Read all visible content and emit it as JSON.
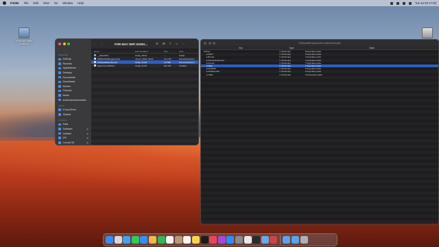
{
  "menubar": {
    "items": [
      "Finder",
      "File",
      "Edit",
      "View",
      "Go",
      "Window",
      "Help"
    ],
    "clock": "Tue Jul 23 17:53"
  },
  "desktop": {
    "icons": [
      {
        "label": "FOR MAC WIFI DONGLE",
        "color": "blue"
      },
      {
        "label": "",
        "color": "gray"
      },
      {
        "label": "",
        "color": "orange"
      },
      {
        "label": "",
        "color": "orange"
      },
      {
        "label": "EFI",
        "color": "gray"
      },
      {
        "label": "Software",
        "color": "gray"
      },
      {
        "label": "EFI",
        "color": "gray"
      }
    ]
  },
  "finder": {
    "title": "FOR MAC WIFI DONG...",
    "toolbar": {
      "view_icon": "list-view-icon",
      "group_icon": "group-icon",
      "share_icon": "share-icon",
      "tag_icon": "tag-icon",
      "more_icon": "more-icon"
    },
    "sidebar": {
      "favorites_header": "Favourites",
      "favorites": [
        "AirDrop",
        "Recents",
        "Applications",
        "Desktop",
        "Documents",
        "Downloads",
        "Movies",
        "Pictures",
        "Music",
        "andrinosmacbookairs"
      ],
      "icloud_header": "iCloud",
      "icloud": [
        "iCloud Drive",
        "Shared"
      ],
      "locations_header": "Locations",
      "locations": [
        "Data",
        "Software",
        "Untitled",
        "EFI",
        "Crucial X8"
      ]
    },
    "columns": [
      "Name",
      "Date Modified",
      "Size",
      "Kind"
    ],
    "rows": [
      {
        "name": "__MACOSX",
        "date": "Today, 18:24",
        "size": "--",
        "kind": "Folder",
        "icon": "folder"
      },
      {
        "name": "IOBCFOrWifiLegacy.kext",
        "date": "June 6, 2022, 18:01",
        "size": "11.1 KB",
        "kind": "Kernel Extension",
        "icon": "doc"
      },
      {
        "name": "IOSkywalkFamily.kext",
        "date": "Today, 21:06",
        "size": "1.8 MB",
        "kind": "Kernel Extension",
        "icon": "doc",
        "selected": true
      },
      {
        "name": "OpenCore-Patcher",
        "date": "Today, 21:06",
        "size": "512 KB",
        "kind": "TextEdit",
        "icon": "doc"
      }
    ]
  },
  "plist": {
    "title": "IOSkywalkFamily.kext/Contents/Info.plist",
    "columns": [
      "Key",
      "Type",
      "Value"
    ],
    "rows": [
      {
        "key": "Root",
        "type": "Dictionary",
        "value": "8 key/value pairs",
        "child": false
      },
      {
        "key": "ACPI",
        "type": "Dictionary",
        "value": "6 key/value pairs",
        "child": true
      },
      {
        "key": "Booter",
        "type": "Dictionary",
        "value": "4 key/value pairs",
        "child": true
      },
      {
        "key": "DeviceProperties",
        "type": "Dictionary",
        "value": "2 key/value pairs",
        "child": true
      },
      {
        "key": "Kernel",
        "type": "Dictionary",
        "value": "7 key/value pairs",
        "child": true
      },
      {
        "key": "Misc",
        "type": "Dictionary",
        "value": "7 key/value pairs",
        "child": true,
        "selected": true
      },
      {
        "key": "NVRAM",
        "type": "Dictionary",
        "value": "5 key/value pairs",
        "child": true
      },
      {
        "key": "PlatformInfo",
        "type": "Dictionary",
        "value": "6 key/value pairs",
        "child": true
      },
      {
        "key": "UEFI",
        "type": "Dictionary",
        "value": "10 key/value pairs",
        "child": true
      }
    ]
  },
  "dock": {
    "apps": [
      {
        "name": "finder-icon",
        "color": "#3d8bf0"
      },
      {
        "name": "launchpad-icon",
        "color": "#d8d8d8"
      },
      {
        "name": "safari-icon",
        "color": "#3fa4ef"
      },
      {
        "name": "messages-icon",
        "color": "#36c75a"
      },
      {
        "name": "mail-icon",
        "color": "#3a8ef5"
      },
      {
        "name": "photos-icon",
        "color": "#f2b84a"
      },
      {
        "name": "facetime-icon",
        "color": "#35b553"
      },
      {
        "name": "calendar-icon",
        "color": "#f4f4f4"
      },
      {
        "name": "contacts-icon",
        "color": "#b89a78"
      },
      {
        "name": "reminders-icon",
        "color": "#f5f5f5"
      },
      {
        "name": "notes-icon",
        "color": "#f6d54a"
      },
      {
        "name": "tv-icon",
        "color": "#1c1c1c"
      },
      {
        "name": "music-icon",
        "color": "#f3405a"
      },
      {
        "name": "podcasts-icon",
        "color": "#a648d8"
      },
      {
        "name": "appstore-icon",
        "color": "#2f8ef5"
      },
      {
        "name": "settings-icon",
        "color": "#8a8a8a"
      },
      {
        "name": "textedit-icon",
        "color": "#e8e8e8"
      },
      {
        "name": "terminal-icon",
        "color": "#2a2a2a"
      },
      {
        "name": "preview-icon",
        "color": "#6aa8e8"
      },
      {
        "name": "opencore-icon",
        "color": "#c44"
      }
    ],
    "right": [
      {
        "name": "downloads-folder-icon",
        "color": "#5ea2ec"
      },
      {
        "name": "folder-icon",
        "color": "#5ea2ec"
      },
      {
        "name": "trash-icon",
        "color": "#b0b0b0"
      }
    ]
  }
}
